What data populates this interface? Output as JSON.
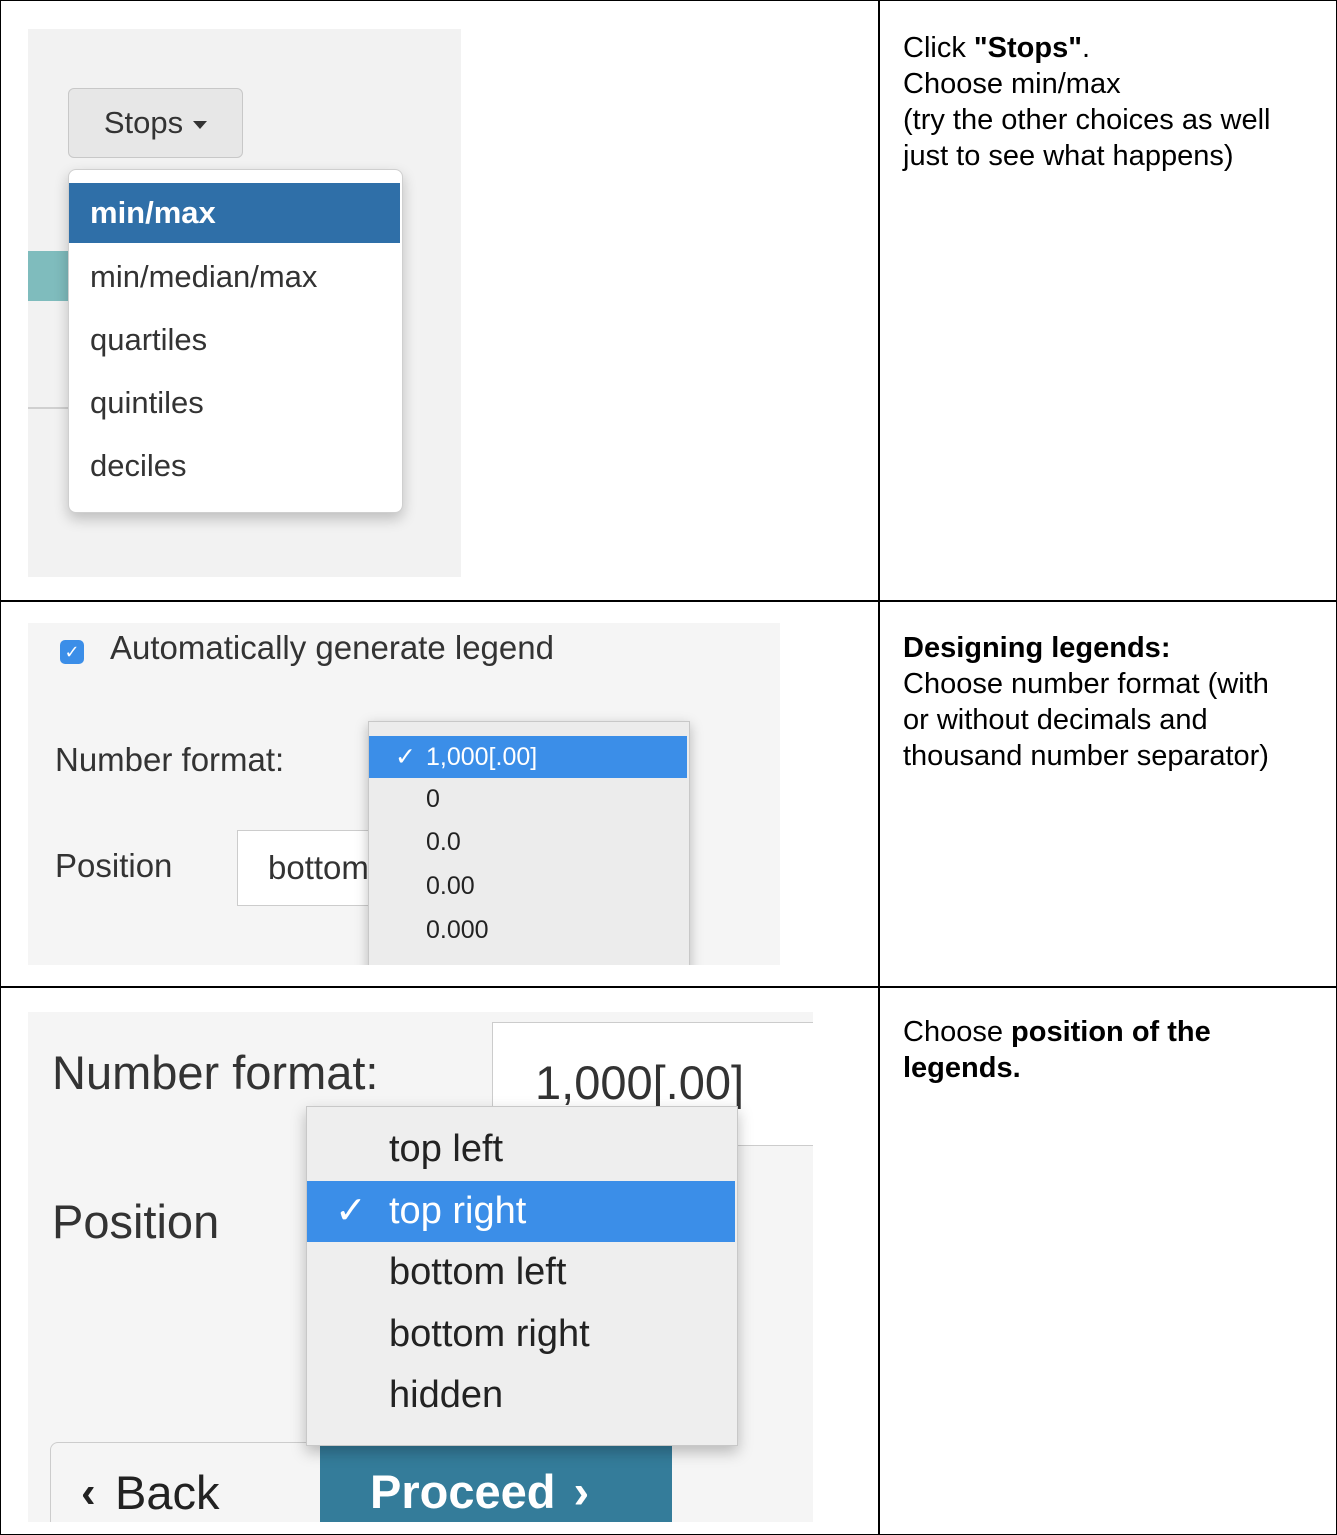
{
  "rows": [
    {
      "instruction": {
        "pre": "Click ",
        "bold": "\"Stops\"",
        "post": ".",
        "lines": [
          "Choose min/max",
          "(try the other choices as well",
          "just to see what happens)"
        ]
      },
      "stops_button": {
        "label": "Stops"
      },
      "stops_menu": [
        "min/max",
        "min/median/max",
        "quartiles",
        "quintiles",
        "deciles"
      ],
      "selected": "min/max"
    },
    {
      "instruction": {
        "bold": "Designing legends:",
        "lines": [
          "Choose number format (with",
          "or without decimals and",
          "thousand number separator)"
        ]
      },
      "checkbox_label": "Automatically generate legend",
      "checkbox_checked": true,
      "number_format_label": "Number format:",
      "position_label": "Position",
      "position_value": "bottom",
      "format_menu": [
        "1,000[.00]",
        "0",
        "0.0",
        "0.00",
        "0.000"
      ],
      "selected": "1,000[.00]"
    },
    {
      "instruction": {
        "pre": "Choose ",
        "bold": "position of the legends.",
        "post": ""
      },
      "number_format_label": "Number format:",
      "number_format_value": "1,000[.00]",
      "position_label": "Position",
      "position_menu": [
        "top left",
        "top right",
        "bottom left",
        "bottom right",
        "hidden"
      ],
      "selected": "top right",
      "back_label": "Back",
      "proceed_label": "Proceed"
    }
  ]
}
